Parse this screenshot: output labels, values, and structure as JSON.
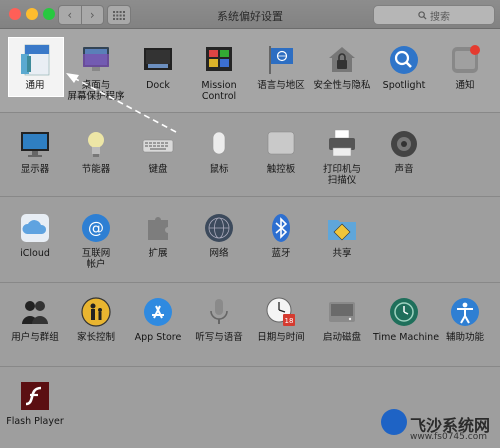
{
  "window": {
    "title": "系统偏好设置",
    "search_placeholder": "搜索"
  },
  "colors": {
    "close": "#ff5f57",
    "minimize": "#febc2e",
    "zoom": "#28c840",
    "background": "#9e9e9e"
  },
  "rows": [
    [
      {
        "id": "general",
        "label": "通用",
        "icon": "general-icon"
      },
      {
        "id": "desktop",
        "label": "桌面与\n屏幕保护程序",
        "icon": "desktop-icon"
      },
      {
        "id": "dock",
        "label": "Dock",
        "icon": "dock-icon"
      },
      {
        "id": "mission",
        "label": "Mission\nControl",
        "icon": "mission-control-icon"
      },
      {
        "id": "language",
        "label": "语言与地区",
        "icon": "flag-icon"
      },
      {
        "id": "security",
        "label": "安全性与隐私",
        "icon": "house-lock-icon"
      },
      {
        "id": "spotlight",
        "label": "Spotlight",
        "icon": "magnifier-icon"
      },
      {
        "id": "notifications",
        "label": "通知",
        "icon": "notification-icon"
      }
    ],
    [
      {
        "id": "displays",
        "label": "显示器",
        "icon": "monitor-icon"
      },
      {
        "id": "energy",
        "label": "节能器",
        "icon": "lightbulb-icon"
      },
      {
        "id": "keyboard",
        "label": "键盘",
        "icon": "keyboard-icon"
      },
      {
        "id": "mouse",
        "label": "鼠标",
        "icon": "mouse-icon"
      },
      {
        "id": "trackpad",
        "label": "触控板",
        "icon": "trackpad-icon"
      },
      {
        "id": "printers",
        "label": "打印机与\n扫描仪",
        "icon": "printer-icon"
      },
      {
        "id": "sound",
        "label": "声音",
        "icon": "speaker-icon"
      }
    ],
    [
      {
        "id": "icloud",
        "label": "iCloud",
        "icon": "cloud-icon"
      },
      {
        "id": "internet",
        "label": "互联网\n帐户",
        "icon": "at-icon"
      },
      {
        "id": "extensions",
        "label": "扩展",
        "icon": "puzzle-icon"
      },
      {
        "id": "network",
        "label": "网络",
        "icon": "globe-icon"
      },
      {
        "id": "bluetooth",
        "label": "蓝牙",
        "icon": "bluetooth-icon"
      },
      {
        "id": "sharing",
        "label": "共享",
        "icon": "folder-sign-icon"
      }
    ],
    [
      {
        "id": "users",
        "label": "用户与群组",
        "icon": "users-icon"
      },
      {
        "id": "parental",
        "label": "家长控制",
        "icon": "parental-icon"
      },
      {
        "id": "appstore",
        "label": "App Store",
        "icon": "appstore-icon"
      },
      {
        "id": "dictation",
        "label": "听写与语音",
        "icon": "microphone-icon"
      },
      {
        "id": "datetime",
        "label": "日期与时间",
        "icon": "clock-icon"
      },
      {
        "id": "startup",
        "label": "启动磁盘",
        "icon": "disk-icon"
      },
      {
        "id": "timemachine",
        "label": "Time Machine",
        "icon": "time-machine-icon"
      },
      {
        "id": "accessibility",
        "label": "辅助功能",
        "icon": "accessibility-icon"
      }
    ],
    [
      {
        "id": "flash",
        "label": "Flash Player",
        "icon": "flash-icon"
      }
    ]
  ],
  "watermark": {
    "name": "飞沙系统网",
    "url": "www.fs0745.com"
  }
}
